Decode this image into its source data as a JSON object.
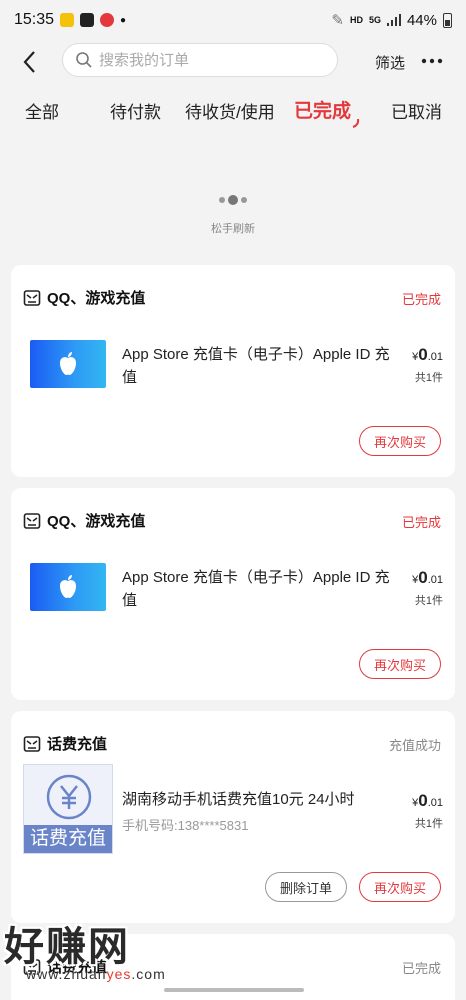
{
  "status_bar": {
    "time": "15:35",
    "network_hd": "HD",
    "network_5g": "5G",
    "battery": "44%"
  },
  "header": {
    "search_placeholder": "搜索我的订单",
    "filter_label": "筛选"
  },
  "tabs": [
    {
      "label": "全部"
    },
    {
      "label": "待付款"
    },
    {
      "label": "待收货/使用"
    },
    {
      "label": "已完成",
      "active": true
    },
    {
      "label": "已取消"
    }
  ],
  "refresh_text": "松手刷新",
  "orders": [
    {
      "shop": "QQ、游戏充值",
      "status": "已完成",
      "title": "App Store 充值卡（电子卡）Apple ID 充值",
      "price_symbol": "¥",
      "price_int": "0",
      "price_dec": ".01",
      "count": "共1件",
      "buttons": [
        "再次购买"
      ]
    },
    {
      "shop": "QQ、游戏充值",
      "status": "已完成",
      "title": "App Store 充值卡（电子卡）Apple ID 充值",
      "price_symbol": "¥",
      "price_int": "0",
      "price_dec": ".01",
      "count": "共1件",
      "buttons": [
        "再次购买"
      ]
    },
    {
      "shop": "话费充值",
      "status": "充值成功",
      "title": "湖南移动手机话费充值10元 24小时",
      "subtitle": "手机号码:138****5831",
      "thumb_label": "话费充值",
      "price_symbol": "¥",
      "price_int": "0",
      "price_dec": ".01",
      "count": "共1件",
      "buttons": [
        "删除订单",
        "再次购买"
      ]
    },
    {
      "shop": "话费充值",
      "status": "已完成"
    }
  ],
  "watermark": {
    "main": "好赚网",
    "sub_prefix": "www.zhuan",
    "sub_highlight": "yes",
    "sub_suffix": ".com"
  },
  "colors": {
    "accent": "#e4393c",
    "background": "#f3f3f3",
    "card": "#ffffff"
  }
}
